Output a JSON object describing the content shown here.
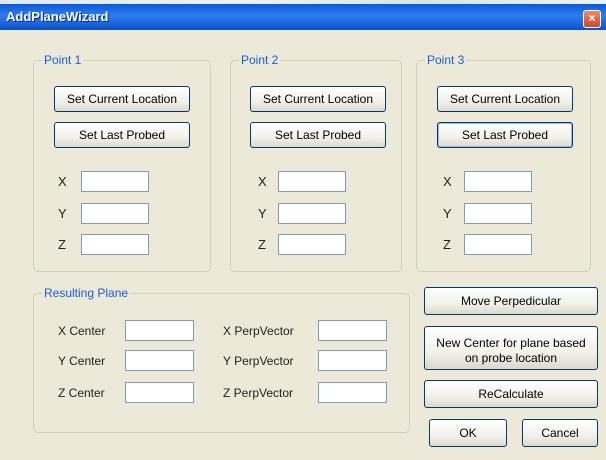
{
  "window": {
    "title": "AddPlaneWizard",
    "close_glyph": "×"
  },
  "points": [
    {
      "legend": "Point 1",
      "set_current": "Set Current Location",
      "set_last": "Set Last Probed",
      "x_label": "X",
      "y_label": "Y",
      "z_label": "Z",
      "x": "",
      "y": "",
      "z": ""
    },
    {
      "legend": "Point 2",
      "set_current": "Set Current Location",
      "set_last": "Set Last Probed",
      "x_label": "X",
      "y_label": "Y",
      "z_label": "Z",
      "x": "",
      "y": "",
      "z": ""
    },
    {
      "legend": "Point 3",
      "set_current": "Set Current Location",
      "set_last": "Set Last Probed",
      "x_label": "X",
      "y_label": "Y",
      "z_label": "Z",
      "x": "",
      "y": "",
      "z": ""
    }
  ],
  "resulting_plane": {
    "legend": "Resulting Plane",
    "x_center_label": "X Center",
    "y_center_label": "Y Center",
    "z_center_label": "Z Center",
    "x_perp_label": "X PerpVector",
    "y_perp_label": "Y PerpVector",
    "z_perp_label": "Z PerpVector",
    "x_center": "",
    "y_center": "",
    "z_center": "",
    "x_perp": "",
    "y_perp": "",
    "z_perp": ""
  },
  "actions": {
    "move_perpendicular": "Move Perpedicular",
    "new_center_line1": "New Center for plane based",
    "new_center_line2": "on probe location",
    "recalculate": "ReCalculate",
    "ok": "OK",
    "cancel": "Cancel"
  }
}
